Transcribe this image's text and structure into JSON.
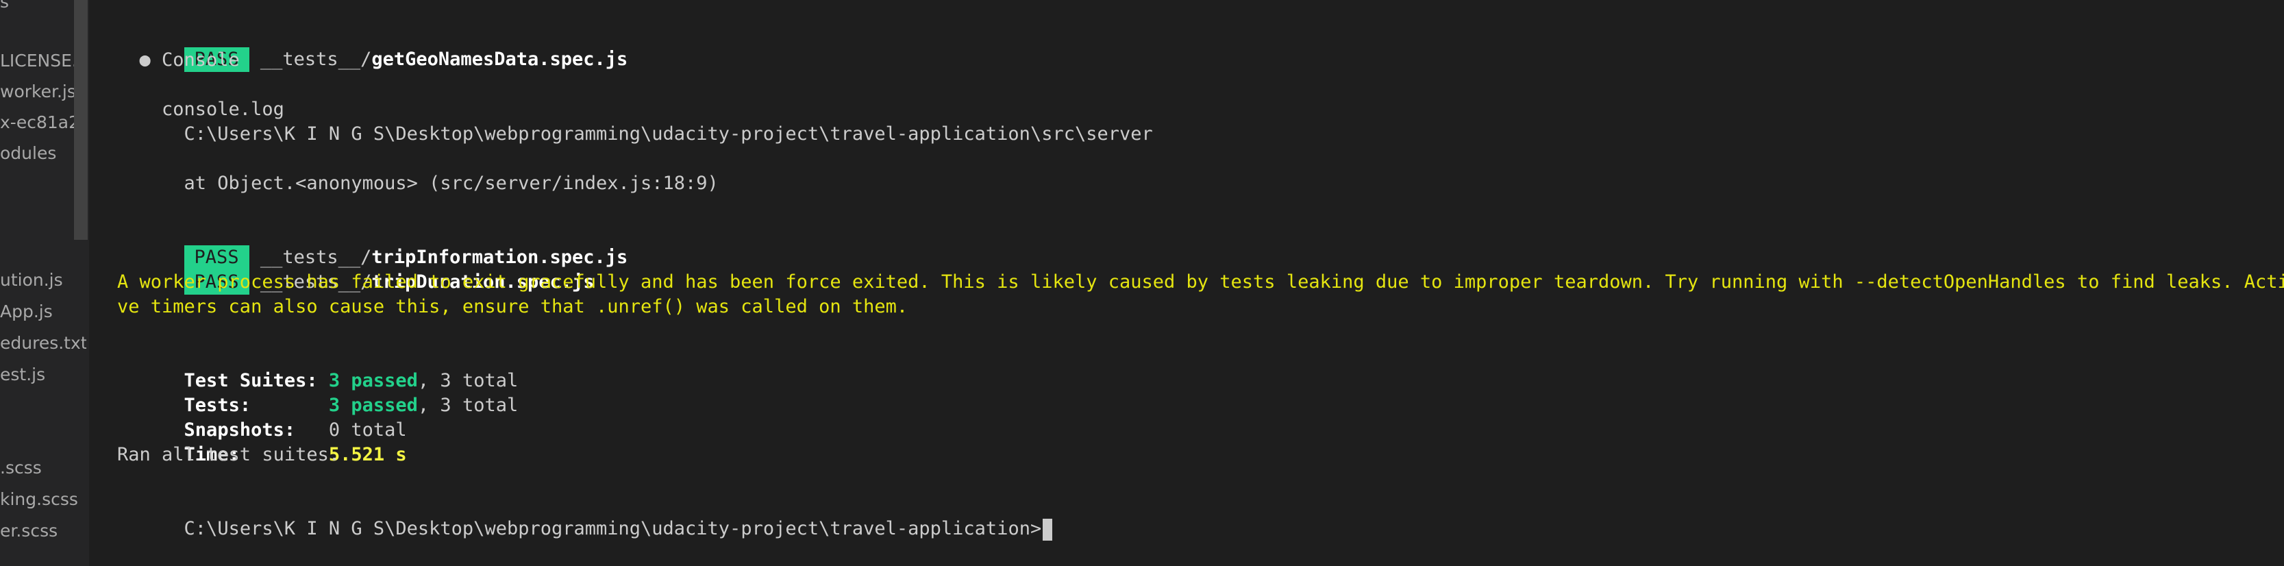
{
  "sidebar": {
    "items": [
      {
        "label": "s"
      },
      {
        "label": "LICENSE..."
      },
      {
        "label": "worker.js"
      },
      {
        "label": "x-ec81a2..."
      },
      {
        "label": "odules"
      },
      {
        "label": "ution.js"
      },
      {
        "label": "App.js"
      },
      {
        "label": "edures.txt"
      },
      {
        "label": "est.js"
      },
      {
        "label": ".scss"
      },
      {
        "label": "king.scss"
      },
      {
        "label": "er.scss"
      }
    ]
  },
  "terminal": {
    "pass_label": "PASS",
    "test1": {
      "prefix": " __tests__/",
      "file": "getGeoNamesData.spec.js"
    },
    "console_bullet": "  ● Console",
    "console_log": "    console.log",
    "console_path": "      C:\\Users\\K I N G S\\Desktop\\webprogramming\\udacity-project\\travel-application\\src\\server",
    "console_at": "      at Object.<anonymous> (src/server/index.js:18:9)",
    "test2": {
      "prefix": " __tests__/",
      "file": "tripInformation.spec.js"
    },
    "test3": {
      "prefix": " __tests__/",
      "file": "tripDuration.spec.js"
    },
    "warning_line1": "A worker process has failed to exit gracefully and has been force exited. This is likely caused by tests leaking due to improper teardown. Try running with --detectOpenHandles to find leaks. Acti",
    "warning_line2": "ve timers can also cause this, ensure that .unref() was called on them.",
    "summary": {
      "suites_label": "Test Suites: ",
      "suites_passed": "3 passed",
      "suites_total": ", 3 total",
      "tests_label": "Tests:       ",
      "tests_passed": "3 passed",
      "tests_total": ", 3 total",
      "snapshots_label": "Snapshots:   ",
      "snapshots_value": "0 total",
      "time_label": "Time:        ",
      "time_value": "5.521 s",
      "ran_all": "Ran all test suites."
    },
    "prompt": "C:\\Users\\K I N G S\\Desktop\\webprogramming\\udacity-project\\travel-application>"
  },
  "colors": {
    "pass_bg": "#23d18b",
    "warning": "#e5e510",
    "time": "#f5f543",
    "background": "#1e1e1e"
  }
}
